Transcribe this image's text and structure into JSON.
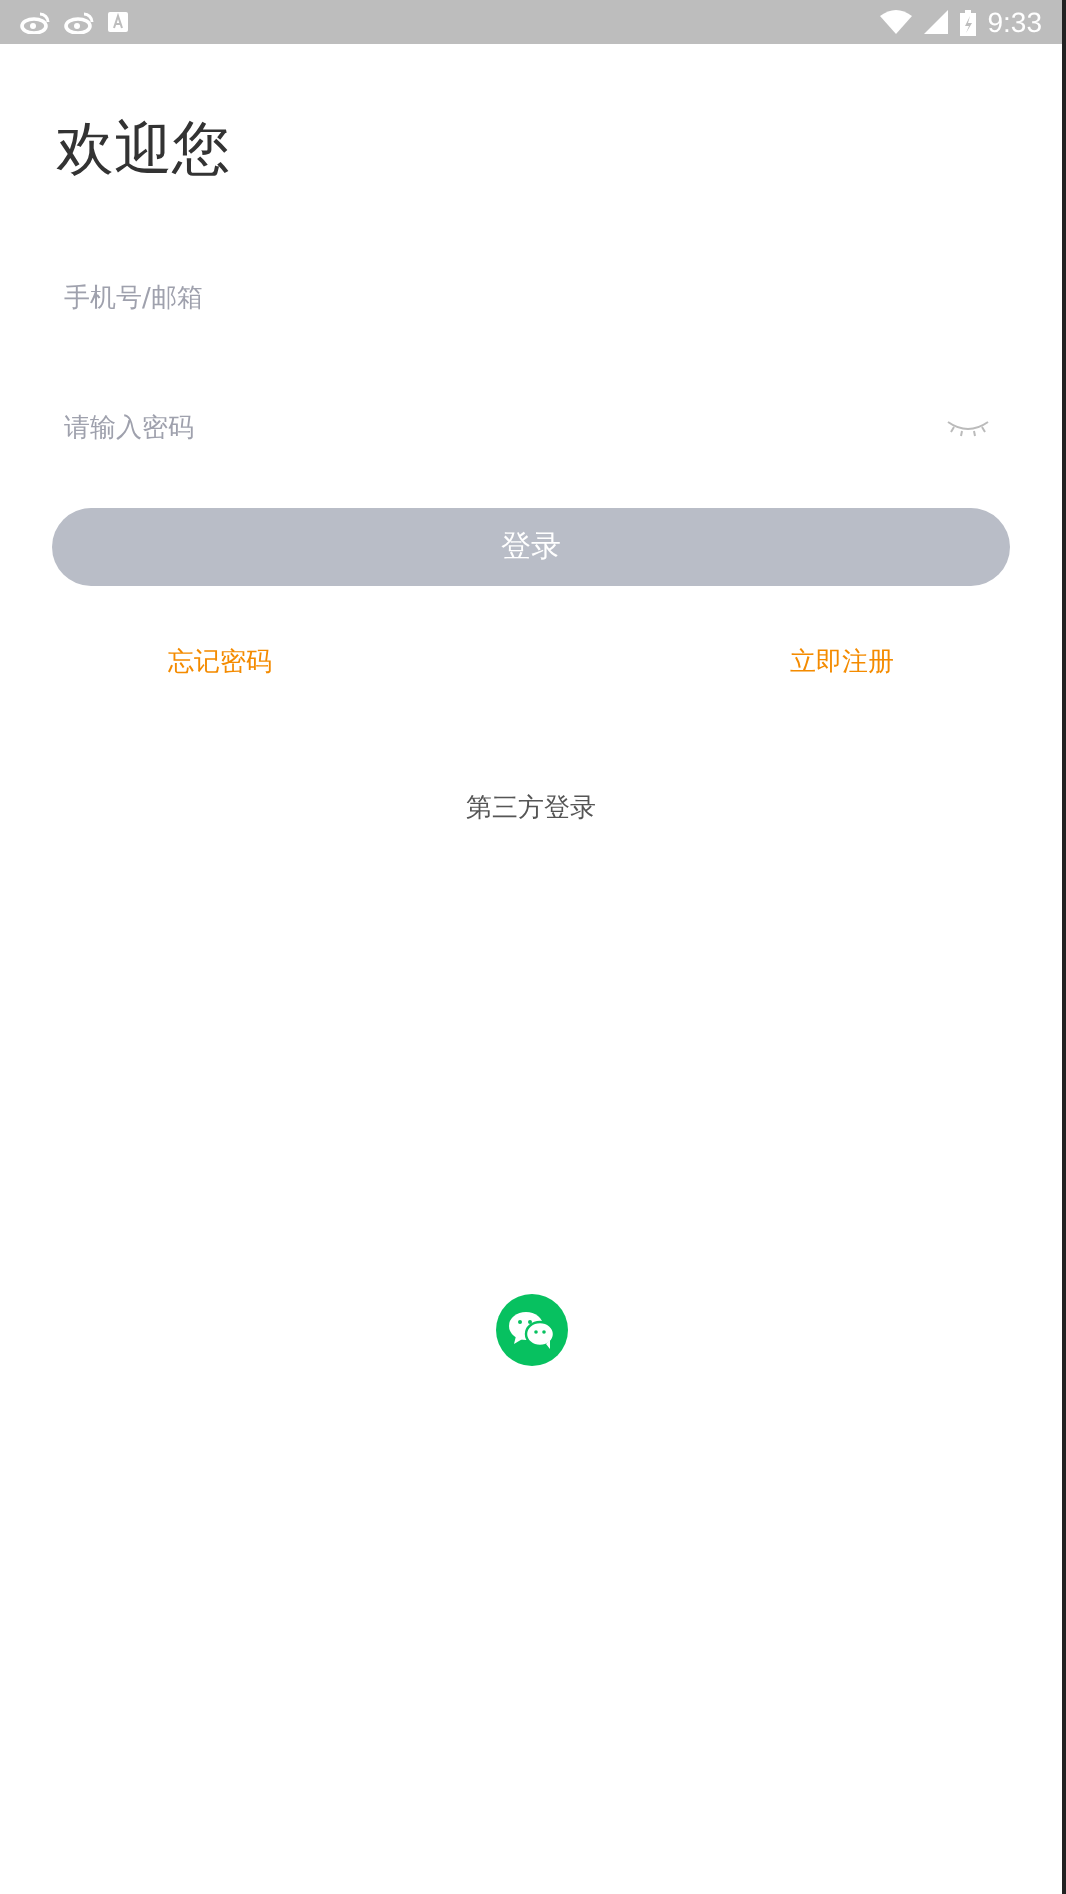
{
  "status_bar": {
    "time": "9:33"
  },
  "title": "欢迎您",
  "phone_field": {
    "placeholder": "手机号/邮箱"
  },
  "password_field": {
    "placeholder": "请输入密码",
    "visible": false
  },
  "login_button": {
    "label": "登录",
    "disabled": true
  },
  "links": [
    {
      "label": "忘记密码"
    },
    {
      "label": "立即注册"
    }
  ],
  "third_party": {
    "label": "第三方登录"
  }
}
